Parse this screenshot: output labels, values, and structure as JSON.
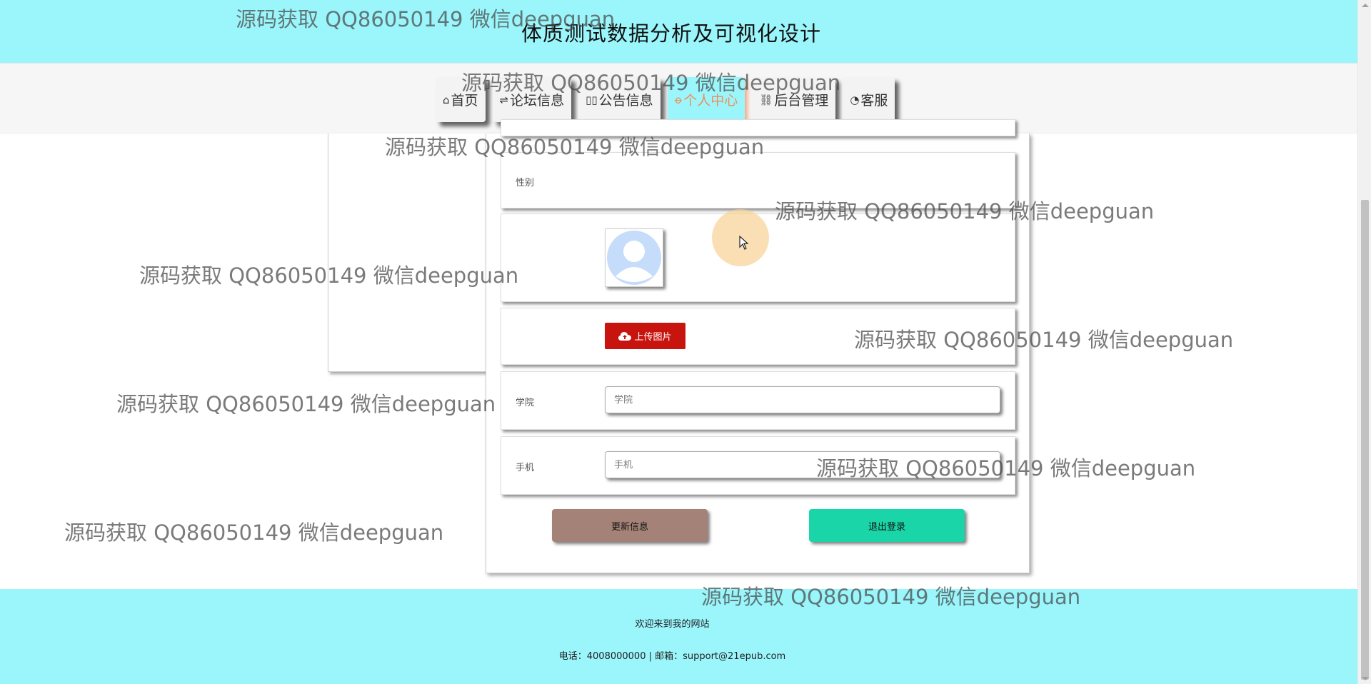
{
  "site": {
    "title": "体质测试数据分析及可视化设计"
  },
  "nav": {
    "items": [
      {
        "label": "首页",
        "icon": "home-icon",
        "glyph": "⌂"
      },
      {
        "label": "论坛信息",
        "icon": "sliders-icon",
        "glyph": "⇌"
      },
      {
        "label": "公告信息",
        "icon": "book-icon",
        "glyph": "▯▯"
      },
      {
        "label": "个人中心",
        "icon": "user-icon",
        "glyph": "ꝋ",
        "active": true
      },
      {
        "label": "后台管理",
        "icon": "link-icon",
        "glyph": "⛓"
      },
      {
        "label": "客服",
        "icon": "chat-icon",
        "glyph": "◔"
      }
    ]
  },
  "form": {
    "gender_label": "性别",
    "upload_label": "上传图片",
    "college_label": "学院",
    "college_placeholder": "学院",
    "phone_label": "手机",
    "phone_placeholder": "手机",
    "update_button": "更新信息",
    "logout_button": "退出登录"
  },
  "footer": {
    "welcome": "欢迎来到我的网站",
    "contact": "电话：4008000000 | 邮箱：support@21epub.com"
  },
  "watermark": "源码获取 QQ86050149 微信deepguan",
  "colors": {
    "header_bg": "#9bf6fc",
    "active_text": "#f08c5a",
    "upload_bg": "#c8140e",
    "update_bg": "#a58277",
    "logout_bg": "#19d5a8"
  }
}
